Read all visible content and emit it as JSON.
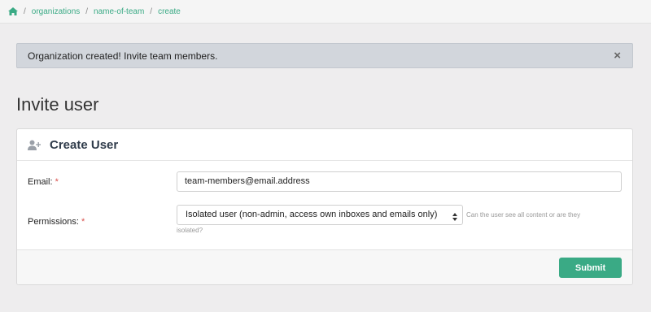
{
  "breadcrumb": {
    "home_icon": "home-icon",
    "items": [
      "organizations",
      "name-of-team",
      "create"
    ],
    "separator": "/"
  },
  "alert": {
    "message": "Organization created! Invite team members.",
    "close_glyph": "×"
  },
  "page": {
    "title": "Invite user"
  },
  "card": {
    "icon": "user-plus-icon",
    "title": "Create User",
    "email": {
      "label": "Email:",
      "required_mark": "*",
      "value": "team-members@email.address"
    },
    "permissions": {
      "label": "Permissions:",
      "required_mark": "*",
      "selected": "Isolated user (non-admin, access own inboxes and emails only)",
      "help_line1": "Can the user see all content or are they",
      "help_line2": "isolated?"
    },
    "submit_label": "Submit"
  },
  "colors": {
    "accent": "#3aaa85",
    "required": "#d9534f",
    "alert_bg": "#d2d6dc"
  }
}
